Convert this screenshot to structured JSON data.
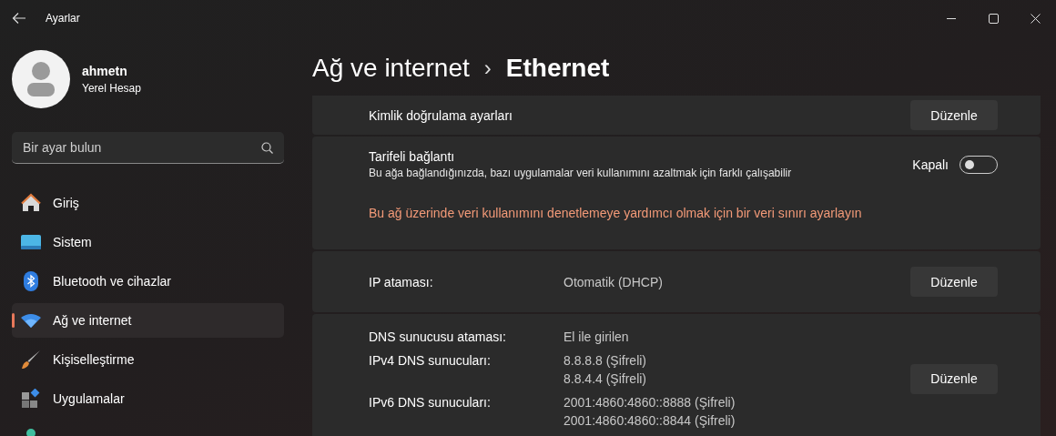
{
  "window": {
    "title": "Ayarlar"
  },
  "user": {
    "name": "ahmetn",
    "account": "Yerel Hesap"
  },
  "search": {
    "placeholder": "Bir ayar bulun"
  },
  "sidebar": {
    "items": [
      {
        "label": "Giriş",
        "kind": "home",
        "selected": false
      },
      {
        "label": "Sistem",
        "kind": "system",
        "selected": false
      },
      {
        "label": "Bluetooth ve cihazlar",
        "kind": "bluetooth",
        "selected": false
      },
      {
        "label": "Ağ ve internet",
        "kind": "network",
        "selected": true
      },
      {
        "label": "Kişiselleştirme",
        "kind": "brush",
        "selected": false
      },
      {
        "label": "Uygulamalar",
        "kind": "apps",
        "selected": false
      },
      {
        "kind": "accounts",
        "selected": false
      }
    ]
  },
  "breadcrumb": {
    "parent": "Ağ ve internet",
    "separator": "›",
    "current": "Ethernet"
  },
  "settings": [
    {
      "kind": "button",
      "label": "Kimlik doğrulama ayarları",
      "button": "Düzenle"
    },
    {
      "kind": "toggle",
      "label": "Tarifeli bağlantı",
      "description": "Bu ağa bağlandığınızda, bazı uygulamalar veri kullanımını azaltmak için farklı çalışabilir",
      "state_label": "Kapalı",
      "on": false,
      "link": "Bu ağ üzerinde veri kullanımını denetlemeye yardımcı olmak için bir veri sınırı ayarlayın"
    },
    {
      "kind": "pairs",
      "rows": [
        {
          "label": "IP ataması:",
          "values": [
            "Otomatik (DHCP)"
          ]
        }
      ],
      "button": "Düzenle"
    },
    {
      "kind": "pairs",
      "rows": [
        {
          "label": "DNS sunucusu ataması:",
          "values": [
            "El ile girilen"
          ]
        },
        {
          "label": "IPv4 DNS sunucuları:",
          "values": [
            "8.8.8.8 (Şifreli)",
            "8.8.4.4 (Şifreli)"
          ]
        },
        {
          "label": "IPv6 DNS sunucuları:",
          "values": [
            "2001:4860:4860::8888 (Şifreli)",
            "2001:4860:4860::8844 (Şifreli)"
          ]
        }
      ],
      "button": "Düzenle"
    }
  ]
}
